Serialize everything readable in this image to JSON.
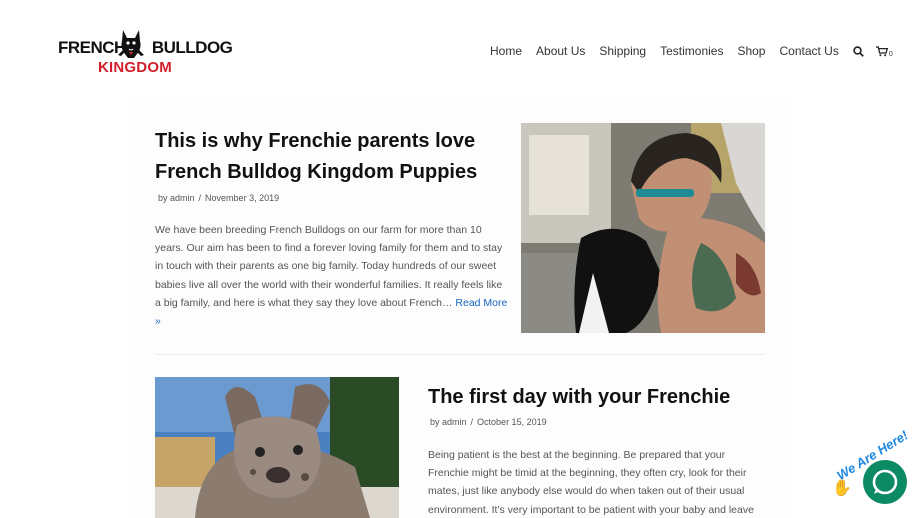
{
  "header": {
    "logo": {
      "line1_left": "FRENCH",
      "line1_right": "BULLDOG",
      "line2": "KINGDOM"
    },
    "nav": [
      {
        "label": "Home"
      },
      {
        "label": "About Us"
      },
      {
        "label": "Shipping"
      },
      {
        "label": "Testimonies"
      },
      {
        "label": "Shop"
      },
      {
        "label": "Contact Us"
      }
    ],
    "search_icon": "search-icon",
    "cart_icon": "cart-icon",
    "cart_count": "0"
  },
  "posts": [
    {
      "title_line1": "This is why Frenchie parents love",
      "title_line2": "French Bulldog Kingdom Puppies",
      "author": "by admin",
      "date": "November 3, 2019",
      "excerpt": "We have been breeding French Bulldogs on our farm for more than 10 years. Our aim has been to find a forever loving family for them and to stay in touch with their parents as one big family. Today hundreds of our sweet babies live all over the world with their wonderful families. It really feels like a big family, and here is what they say they love about French…",
      "read_more_a": "Read",
      "read_more_b": "More »"
    },
    {
      "title": "The first day with your Frenchie",
      "author": "by admin",
      "date": "October 15, 2019",
      "excerpt": "Being patient is the best at the beginning. Be prepared that your Frenchie might be timid at the beginning, they often cry, look for their mates, just like anybody else would do when taken out of their usual environment. It's very important to be patient with your baby and leave"
    }
  ],
  "chat_widget": {
    "label": "We Are Here!"
  },
  "colors": {
    "accent_link": "#1565c0",
    "logo_red": "#d11f2b",
    "chat_green": "#0b8a63"
  }
}
